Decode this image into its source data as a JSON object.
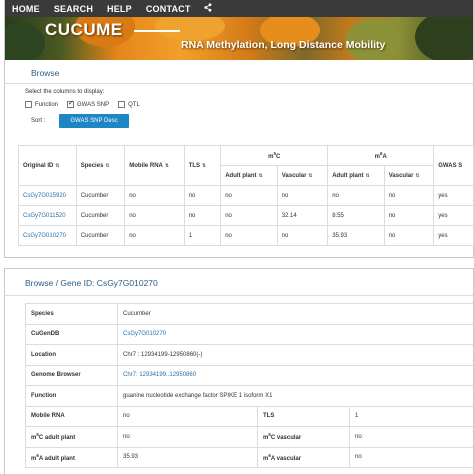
{
  "nav": {
    "items": [
      "HOME",
      "SEARCH",
      "HELP",
      "CONTACT"
    ],
    "share_icon": "share-icon"
  },
  "banner": {
    "title": "CUCUME",
    "subtitle": "RNA Methylation, Long Distance Mobility"
  },
  "browse": {
    "title": "Browse",
    "select_label": "Select the columns to display:",
    "columns": [
      {
        "label": "Function",
        "checked": false
      },
      {
        "label": "GWAS SNP",
        "checked": true
      },
      {
        "label": "QTL",
        "checked": false
      }
    ],
    "sort_label": "Sort :",
    "sort_button": "GWAS SNP Desc"
  },
  "table": {
    "headers": {
      "original_id": "Original ID",
      "species": "Species",
      "mobile_rna": "Mobile RNA",
      "tls": "TLS",
      "m5c_group": "m5C",
      "m6a_group": "m6A",
      "adult_plant": "Adult plant",
      "vascular": "Vascular",
      "gwas": "GWAS S"
    },
    "rows": [
      {
        "id": "CsGy7G015920",
        "species": "Cucumber",
        "mobile": "no",
        "tls": "no",
        "m5c_adult": "no",
        "m5c_vasc": "no",
        "m6a_adult": "no",
        "m6a_vasc": "no",
        "gwas": "yes"
      },
      {
        "id": "CsGy7G011520",
        "species": "Cucumber",
        "mobile": "no",
        "tls": "no",
        "m5c_adult": "no",
        "m5c_vasc": "32.14",
        "m6a_adult": "8.55",
        "m6a_vasc": "no",
        "gwas": "yes"
      },
      {
        "id": "CsGy7G010270",
        "species": "Cucumber",
        "mobile": "no",
        "tls": "1",
        "m5c_adult": "no",
        "m5c_vasc": "no",
        "m6a_adult": "35.93",
        "m6a_vasc": "no",
        "gwas": "yes"
      }
    ]
  },
  "detail": {
    "crumb_browse": "Browse",
    "crumb_rest": " / Gene ID: CsGy7G010270",
    "rows": {
      "species_k": "Species",
      "species_v": "Cucumber",
      "cugendb_k": "CuGenDB",
      "cugendb_v": "CsGy7G010270",
      "location_k": "Location",
      "location_v": "Chr7 : 12934199-12950860(-)",
      "genome_k": "Genome Browser",
      "genome_v": "Chr7: 12934199..12950860",
      "function_k": "Function",
      "function_v": "guanine nucleotide exchange factor SPIKE 1 isoform X1",
      "mobile_k": "Mobile RNA",
      "mobile_v": "no",
      "tls_k": "TLS",
      "tls_v": "1",
      "m5c_adult_k": "m5C adult plant",
      "m5c_adult_v": "no",
      "m5c_vasc_k": "m5C vascular",
      "m5c_vasc_v": "no",
      "m6a_adult_k": "m6A adult plant",
      "m6a_adult_v": "35.93",
      "m6a_vasc_k": "m6A vascular",
      "m6a_vasc_v": "no"
    }
  },
  "colors": {
    "nav_bg": "#3a3a3a",
    "link": "#2b6fa8",
    "title": "#2b5d86",
    "button": "#1d86c4"
  }
}
